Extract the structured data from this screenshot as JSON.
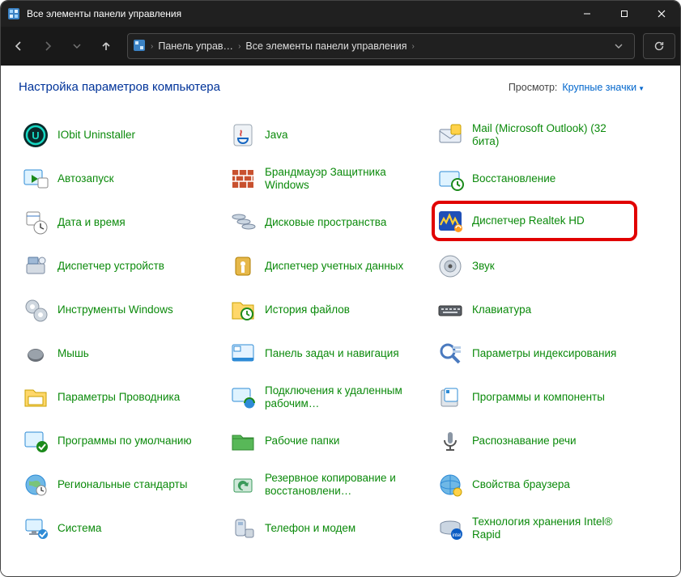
{
  "window": {
    "title": "Все элементы панели управления"
  },
  "breadcrumb": {
    "level1": "Панель управ…",
    "level2": "Все элементы панели управления"
  },
  "header": {
    "title": "Настройка параметров компьютера",
    "view_label": "Просмотр:",
    "view_value": "Крупные значки"
  },
  "items": [
    {
      "label": "IObit Uninstaller",
      "icon": "iobit"
    },
    {
      "label": "Java",
      "icon": "java"
    },
    {
      "label": "Mail (Microsoft Outlook) (32 бита)",
      "icon": "mail"
    },
    {
      "label": "Автозапуск",
      "icon": "autoplay"
    },
    {
      "label": "Брандмауэр Защитника Windows",
      "icon": "firewall"
    },
    {
      "label": "Восстановление",
      "icon": "recovery"
    },
    {
      "label": "Дата и время",
      "icon": "datetime"
    },
    {
      "label": "Дисковые пространства",
      "icon": "storage"
    },
    {
      "label": "Диспетчер Realtek HD",
      "icon": "realtek",
      "hl": true
    },
    {
      "label": "Диспетчер устройств",
      "icon": "devmgr"
    },
    {
      "label": "Диспетчер учетных данных",
      "icon": "cred"
    },
    {
      "label": "Звук",
      "icon": "sound"
    },
    {
      "label": "Инструменты Windows",
      "icon": "tools"
    },
    {
      "label": "История файлов",
      "icon": "filehist"
    },
    {
      "label": "Клавиатура",
      "icon": "keyboard"
    },
    {
      "label": "Мышь",
      "icon": "mouse"
    },
    {
      "label": "Панель задач и навигация",
      "icon": "taskbar"
    },
    {
      "label": "Параметры индексирования",
      "icon": "indexing"
    },
    {
      "label": "Параметры Проводника",
      "icon": "explorer"
    },
    {
      "label": "Подключения к удаленным рабочим…",
      "icon": "remote"
    },
    {
      "label": "Программы и компоненты",
      "icon": "programs"
    },
    {
      "label": "Программы по умолчанию",
      "icon": "defaults"
    },
    {
      "label": "Рабочие папки",
      "icon": "workfolders"
    },
    {
      "label": "Распознавание речи",
      "icon": "speech"
    },
    {
      "label": "Региональные стандарты",
      "icon": "region"
    },
    {
      "label": "Резервное копирование и восстановлени…",
      "icon": "backup"
    },
    {
      "label": "Свойства браузера",
      "icon": "inet"
    },
    {
      "label": "Система",
      "icon": "system"
    },
    {
      "label": "Телефон и модем",
      "icon": "phone"
    },
    {
      "label": "Технология хранения Intel® Rapid",
      "icon": "intel"
    }
  ]
}
